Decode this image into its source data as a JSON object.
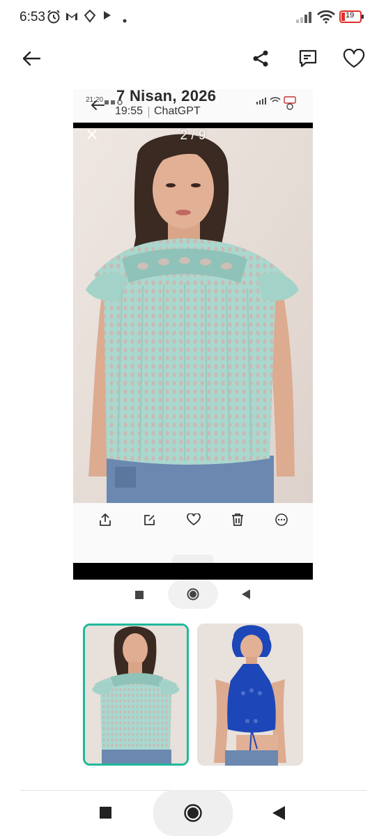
{
  "status_bar": {
    "time": "6:53",
    "battery": "19"
  },
  "screenshot": {
    "date_heading": "7 Nisan, 2026",
    "inner_status_time": "21:20",
    "app_time": "19:55",
    "app_name": "ChatGPT",
    "image_counter": "2 / 9"
  },
  "icons": {
    "toolbar": [
      "back-arrow-icon",
      "share-icon",
      "comment-icon",
      "heart-icon"
    ],
    "screenshot_actions": [
      "share-icon",
      "edit-icon",
      "heart-icon",
      "trash-icon",
      "more-icon"
    ],
    "navigation": [
      "recents-icon",
      "home-icon",
      "back-icon"
    ]
  },
  "colors": {
    "selected_border": "#1fb99b",
    "top_color_1": "#a8d8cf",
    "top_color_2": "#1d47b8",
    "battery_low": "#e0302c"
  }
}
